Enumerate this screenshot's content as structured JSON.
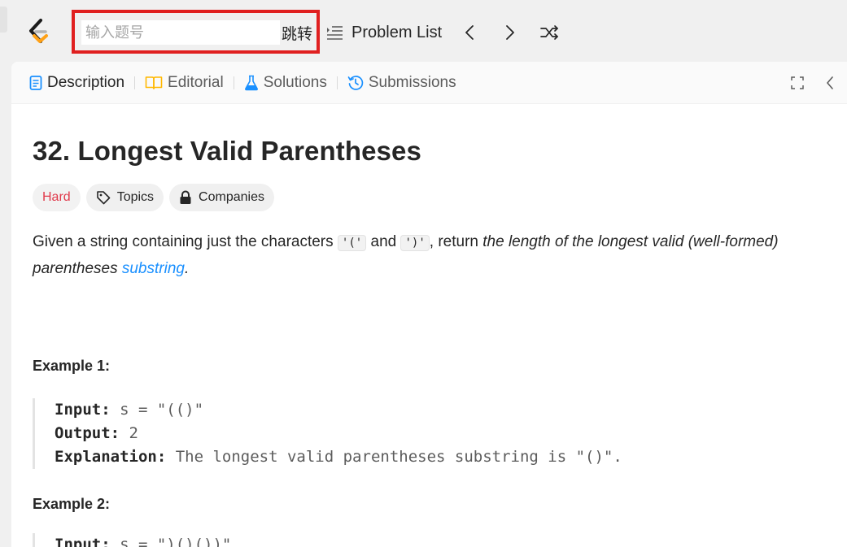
{
  "topbar": {
    "jump_placeholder": "输入题号",
    "jump_button": "跳转",
    "problem_list_label": "Problem List"
  },
  "tabs": [
    {
      "label": "Description",
      "icon": "document-icon",
      "active": true
    },
    {
      "label": "Editorial",
      "icon": "book-icon",
      "active": false
    },
    {
      "label": "Solutions",
      "icon": "flask-icon",
      "active": false
    },
    {
      "label": "Submissions",
      "icon": "history-icon",
      "active": false
    }
  ],
  "problem": {
    "title": "32. Longest Valid Parentheses",
    "difficulty": "Hard",
    "topics_label": "Topics",
    "companies_label": "Companies",
    "desc_prefix": "Given a string containing just the characters ",
    "char_open": "'('",
    "desc_and": " and ",
    "char_close": "')'",
    "desc_middle": ", return ",
    "desc_italic": "the length of the longest valid (well-formed) parentheses ",
    "desc_link": "substring",
    "desc_end": "."
  },
  "examples": [
    {
      "heading": "Example 1:",
      "input_label": "Input:",
      "input_value": " s = \"(()\"",
      "output_label": "Output:",
      "output_value": " 2",
      "explanation_label": "Explanation:",
      "explanation_value": " The longest valid parentheses substring is \"()\"."
    },
    {
      "heading": "Example 2:",
      "input_label": "Input:",
      "input_value": " s = \")()())\""
    }
  ],
  "colors": {
    "accent_red": "#e02020",
    "hard": "#e0394b",
    "link": "#1a90ff",
    "editorial_icon": "#ffb800",
    "solutions_icon": "#1a90ff",
    "submissions_icon": "#1a90ff",
    "logo_orange": "#ffa116"
  }
}
